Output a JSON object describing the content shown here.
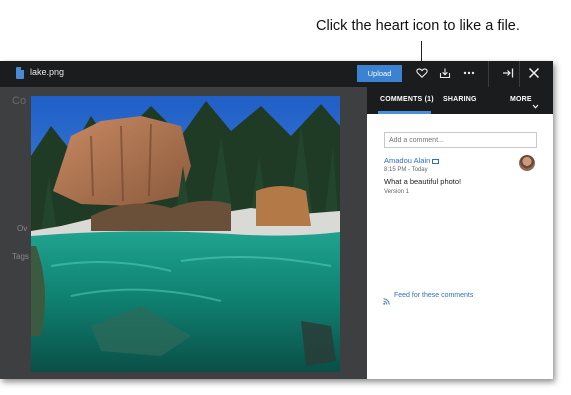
{
  "callout": {
    "text": "Click the heart icon to like a file."
  },
  "topbar": {
    "filename": "lake.png",
    "file_icon": "file-icon",
    "upload_label": "Upload",
    "icons": [
      "heart-icon",
      "download-icon",
      "more-icon",
      "collapse-panel-icon",
      "close-icon"
    ]
  },
  "background": {
    "ghost_title": "Co",
    "ghost_ov": "Ov",
    "ghost_tags": "Tags"
  },
  "viewer": {
    "zoom_controls": [
      "zoom-out-icon",
      "fit-screen-icon",
      "zoom-in-icon"
    ]
  },
  "panel": {
    "tabs": [
      {
        "label": "COMMENTS (1)",
        "active": true
      },
      {
        "label": "SHARING",
        "active": false
      }
    ],
    "more_label": "MORE",
    "comment_placeholder": "Add a comment...",
    "comments": [
      {
        "author": "Amadou Alain",
        "time": "8:15 PM - Today",
        "text": "What a beautiful photo!",
        "version": "Version 1"
      }
    ],
    "feed_link": "Feed for these comments"
  },
  "colors": {
    "topbar": "#1b1c1e",
    "accent": "#3b83d0",
    "link": "#2f6fbf",
    "tab_underline": "#4a8fd9"
  }
}
